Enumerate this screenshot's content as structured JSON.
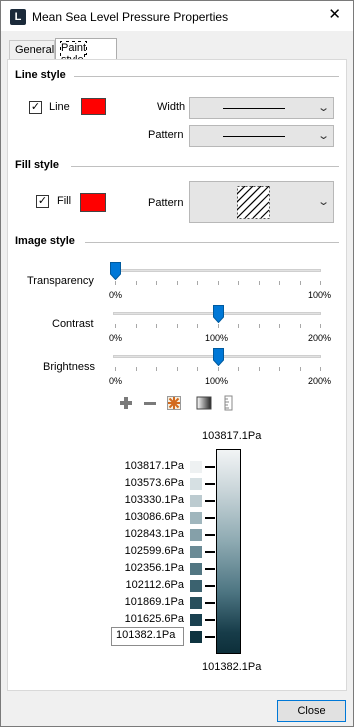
{
  "window": {
    "title": "Mean Sea Level Pressure Properties",
    "app_icon_letter": "L",
    "close_glyph": "✕"
  },
  "tabs": [
    {
      "label": "General"
    },
    {
      "label": "Paint style"
    }
  ],
  "line_style": {
    "heading": "Line style",
    "checkbox_label": "Line",
    "checked": true,
    "color": "#ff0000",
    "width_label": "Width",
    "pattern_label": "Pattern"
  },
  "fill_style": {
    "heading": "Fill style",
    "checkbox_label": "Fill",
    "checked": true,
    "color": "#ff0000",
    "pattern_label": "Pattern"
  },
  "image_style": {
    "heading": "Image style",
    "transparency": {
      "label": "Transparency",
      "value_percent": 0,
      "min_label": "0%",
      "max_label": "100%"
    },
    "contrast": {
      "label": "Contrast",
      "value_percent": 100,
      "min_label": "0%",
      "mid_label": "100%",
      "max_label": "200%"
    },
    "brightness": {
      "label": "Brightness",
      "value_percent": 100,
      "min_label": "0%",
      "mid_label": "100%",
      "max_label": "200%"
    }
  },
  "toolbar_icons": [
    "add-icon",
    "remove-icon",
    "color-edit-icon",
    "gradient-icon",
    "ruler-icon"
  ],
  "legend": {
    "top_value": "103817.1Pa",
    "bottom_value": "101382.1Pa",
    "rows": [
      {
        "label": "103817.1Pa",
        "color": "#eef1f2"
      },
      {
        "label": "103573.6Pa",
        "color": "#d6e0e3"
      },
      {
        "label": "103330.1Pa",
        "color": "#bccbd0"
      },
      {
        "label": "103086.6Pa",
        "color": "#a0b6bd"
      },
      {
        "label": "102843.1Pa",
        "color": "#85a0a9"
      },
      {
        "label": "102599.6Pa",
        "color": "#6b8b96"
      },
      {
        "label": "102356.1Pa",
        "color": "#527682"
      },
      {
        "label": "102112.6Pa",
        "color": "#3b626f"
      },
      {
        "label": "101869.1Pa",
        "color": "#284f5c"
      },
      {
        "label": "101625.6Pa",
        "color": "#1a4150"
      },
      {
        "label": "101382.1Pa",
        "color": "#0f3440"
      }
    ]
  },
  "buttons": {
    "close": "Close"
  }
}
